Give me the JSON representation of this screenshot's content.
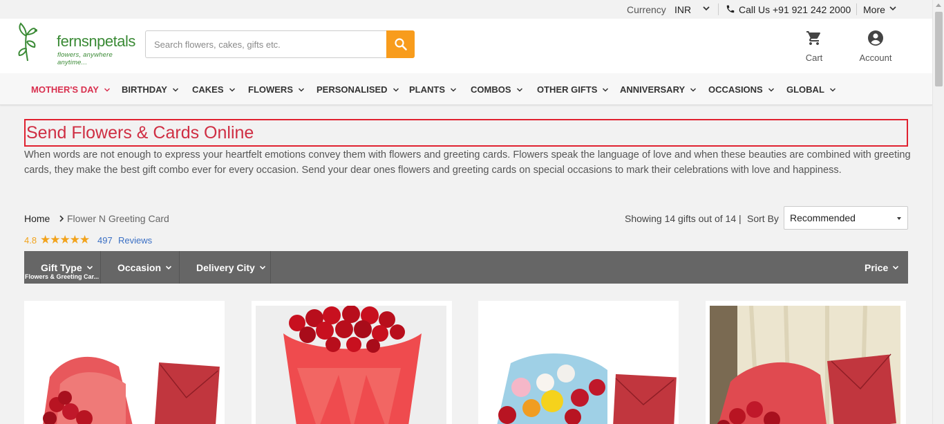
{
  "topbar": {
    "currency_label": "Currency",
    "currency_value": "INR",
    "call_label": "Call Us +91 921 242 2000",
    "more_label": "More"
  },
  "header": {
    "logo_word": "fernsnpetals",
    "logo_tagline": "flowers, anywhere anytime...",
    "search_placeholder": "Search flowers, cakes, gifts etc.",
    "cart_label": "Cart",
    "account_label": "Account",
    "accent_color": "#f89c1c",
    "brand_color": "#3a8a35"
  },
  "nav": {
    "items": [
      {
        "label": "MOTHER'S DAY"
      },
      {
        "label": "BIRTHDAY"
      },
      {
        "label": "CAKES"
      },
      {
        "label": "FLOWERS"
      },
      {
        "label": "PERSONALISED"
      },
      {
        "label": "PLANTS"
      },
      {
        "label": "COMBOS"
      },
      {
        "label": "OTHER GIFTS"
      },
      {
        "label": "ANNIVERSARY"
      },
      {
        "label": "OCCASIONS"
      },
      {
        "label": "GLOBAL"
      }
    ],
    "highlight_color": "#d9304f"
  },
  "page": {
    "title": "Send Flowers & Cards Online",
    "intro": "When words are not enough to express your heartfelt emotions convey them with flowers and greeting cards. Flowers speak the language of love and when these beauties are combined with greeting cards, they make the best gift combo ever for every occasion. Send your dear ones flowers and greeting cards on special occasions to mark their celebrations with love and happiness."
  },
  "breadcrumb": {
    "home": "Home",
    "current": "Flower N Greeting Card"
  },
  "rating": {
    "value": "4.8",
    "stars": "★★★★★",
    "review_count": "497",
    "review_label": "Reviews"
  },
  "listing": {
    "showing": "Showing 14 gifts out of 14 |",
    "sort_label": "Sort By",
    "sort_value": "Recommended"
  },
  "filters": {
    "gift_type": "Gift Type",
    "gift_type_sub": "Flowers & Greeting Car...",
    "occasion": "Occasion",
    "delivery_city": "Delivery City",
    "price": "Price"
  },
  "products": [
    {
      "image": "red-roses-with-red-envelope"
    },
    {
      "image": "red-roses-bouquet-in-red-paper"
    },
    {
      "image": "mixed-roses-with-red-envelope"
    },
    {
      "image": "red-roses-with-red-envelope-on-curtain"
    }
  ]
}
